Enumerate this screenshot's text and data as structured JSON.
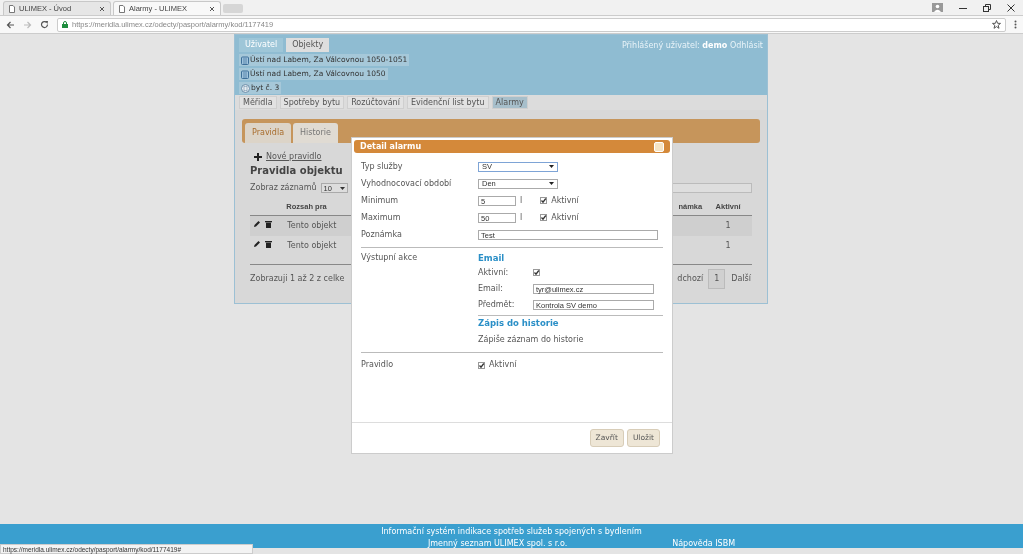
{
  "browser": {
    "tabs": [
      {
        "title": "ULIMEX - Úvod",
        "selected": false
      },
      {
        "title": "Alarmy - ULIMEX",
        "selected": true
      }
    ],
    "url": "https://meridla.ulimex.cz/odecty/pasport/alarmy/kod/1177419"
  },
  "header": {
    "nav_tabs": [
      {
        "label": "Uživatel",
        "selected": false
      },
      {
        "label": "Objekty",
        "selected": true
      }
    ],
    "login_label": "Přihlášený uživatel:",
    "user": "demo",
    "logout": "Odhlásit"
  },
  "breadcrumbs": [
    {
      "kind": "building",
      "text": "Ústí nad Labem, Za Válcovnou 1050-1051"
    },
    {
      "kind": "building",
      "text": "Ústí nad Labem, Za Válcovnou 1050"
    },
    {
      "kind": "flat",
      "text": "byt č. 3"
    }
  ],
  "section_tabs": [
    {
      "label": "Měřidla",
      "selected": false
    },
    {
      "label": "Spotřeby bytu",
      "selected": false
    },
    {
      "label": "Rozúčtování",
      "selected": false
    },
    {
      "label": "Evidenční list bytu",
      "selected": false
    },
    {
      "label": "Alarmy",
      "selected": true
    }
  ],
  "inner_tabs": [
    {
      "label": "Pravidla",
      "selected": true
    },
    {
      "label": "Historie",
      "selected": false
    }
  ],
  "rules": {
    "new_rule": "Nové pravidlo",
    "heading": "Pravidla objektu",
    "page_size_label": "Zobraz záznamů",
    "page_size": "10",
    "columns": [
      "Rozsah pra",
      "námka",
      "Aktivní"
    ],
    "rows": [
      {
        "scope": "Tento objekt",
        "active": "1"
      },
      {
        "scope": "Tento objekt",
        "active": "1"
      }
    ],
    "summary": "Zobrazuji 1 až 2 z celke",
    "prev": "dchozí",
    "page": "1",
    "next": "Další"
  },
  "modal": {
    "title": "Detail alarmu",
    "fields": [
      {
        "kind": "select",
        "label": "Typ služby",
        "value": "SV"
      },
      {
        "kind": "select",
        "label": "Vyhodnocovací období",
        "value": "Den"
      },
      {
        "kind": "limit",
        "label": "Minimum",
        "value": "5",
        "unit": "l",
        "checked": true,
        "check_label": "Aktivní"
      },
      {
        "kind": "limit",
        "label": "Maximum",
        "value": "50",
        "unit": "l",
        "checked": true,
        "check_label": "Aktivní"
      },
      {
        "kind": "text",
        "label": "Poznámka",
        "value": "Test"
      }
    ],
    "output_label": "Výstupní akce",
    "email_heading": "Email",
    "email_rows": [
      {
        "kind": "checkbox",
        "label": "Aktivní:",
        "checked": true
      },
      {
        "kind": "text",
        "label": "Email:",
        "value": "tyr@ulimex.cz"
      },
      {
        "kind": "text",
        "label": "Předmět:",
        "value": "Kontrola SV demo"
      }
    ],
    "history_heading": "Zápis do historie",
    "history_text": "Zápiše záznam do historie",
    "rule_label": "Pravidlo",
    "rule_checked": true,
    "rule_check_label": "Aktivní",
    "buttons": [
      "Zavřít",
      "Uložit"
    ]
  },
  "footer": {
    "text": "Informační systém indikace spotřeb služeb spojených s bydlením",
    "links": [
      "Jmenný seznam ULIMEX spol. s r.o.",
      "Nápověda ISBM"
    ]
  },
  "status_url": "https://meridla.ulimex.cz/odecty/pasport/alarmy/kod/1177419#"
}
